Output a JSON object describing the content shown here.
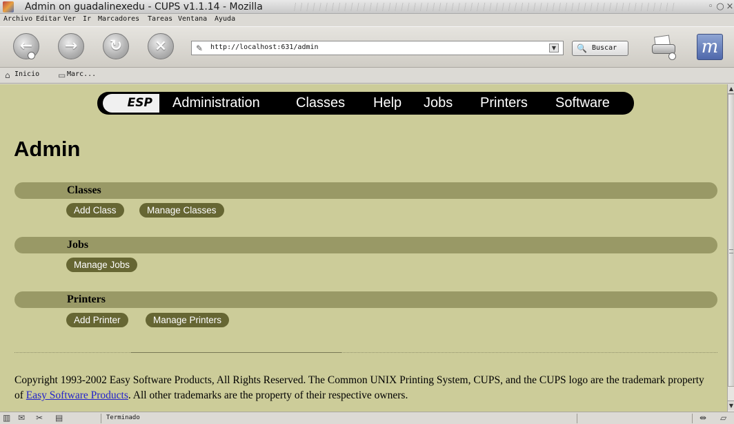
{
  "window": {
    "title": "Admin on guadalinexedu - CUPS v1.1.14 - Mozilla"
  },
  "menu": {
    "items": [
      "Archivo",
      "Editar",
      "Ver",
      "Ir",
      "Marcadores",
      "Tareas",
      "Ventana",
      "Ayuda"
    ]
  },
  "navbar": {
    "url": "http://localhost:631/admin",
    "search_label": "Buscar"
  },
  "personal_toolbar": {
    "items": [
      "Inicio",
      "Marc..."
    ]
  },
  "cups": {
    "brand": "ESP",
    "nav": [
      "Administration",
      "Classes",
      "Help",
      "Jobs",
      "Printers",
      "Software"
    ],
    "page_title": "Admin",
    "sections": [
      {
        "heading": "Classes",
        "buttons": [
          "Add Class",
          "Manage Classes"
        ]
      },
      {
        "heading": "Jobs",
        "buttons": [
          "Manage Jobs"
        ]
      },
      {
        "heading": "Printers",
        "buttons": [
          "Add Printer",
          "Manage Printers"
        ]
      }
    ],
    "footer": {
      "text_before": "Copyright 1993-2002 Easy Software Products, All Rights Reserved. The Common UNIX Printing System, CUPS, and the CUPS logo are the trademark property of ",
      "link": "Easy Software Products",
      "text_after": ". All other trademarks are the property of their respective owners."
    }
  },
  "status": {
    "text": "Terminado"
  },
  "colors": {
    "content_bg": "#cccc99",
    "section_bar": "#999966",
    "button_pill": "#666633",
    "nav_bar": "#000000"
  },
  "icons": {
    "back": "back-arrow-icon",
    "forward": "forward-arrow-icon",
    "reload": "reload-icon",
    "stop": "stop-icon",
    "print": "print-icon",
    "throbber": "mozilla-logo-icon",
    "home": "home-icon",
    "bookmarks": "bookmark-folder-icon"
  }
}
